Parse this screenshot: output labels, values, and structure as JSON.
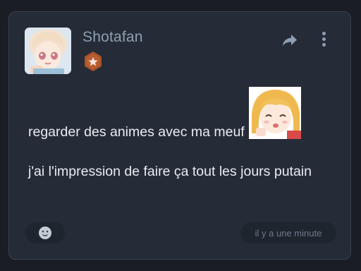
{
  "post": {
    "username": "Shotafan",
    "text_line1": "regarder des animes avec ma meuf",
    "text_para2": "j'ai l'impression de faire ça tout les jours putain",
    "timestamp": "il y a une minute"
  },
  "icons": {
    "share": "share-arrow-icon",
    "more": "vertical-dots-icon",
    "badge": "star-hexagon-badge-icon",
    "react": "emoji-react-icon"
  },
  "colors": {
    "card_bg": "#252c37",
    "username": "#8e9fb1",
    "text": "#e9edf2",
    "badge": "#a8522a"
  }
}
